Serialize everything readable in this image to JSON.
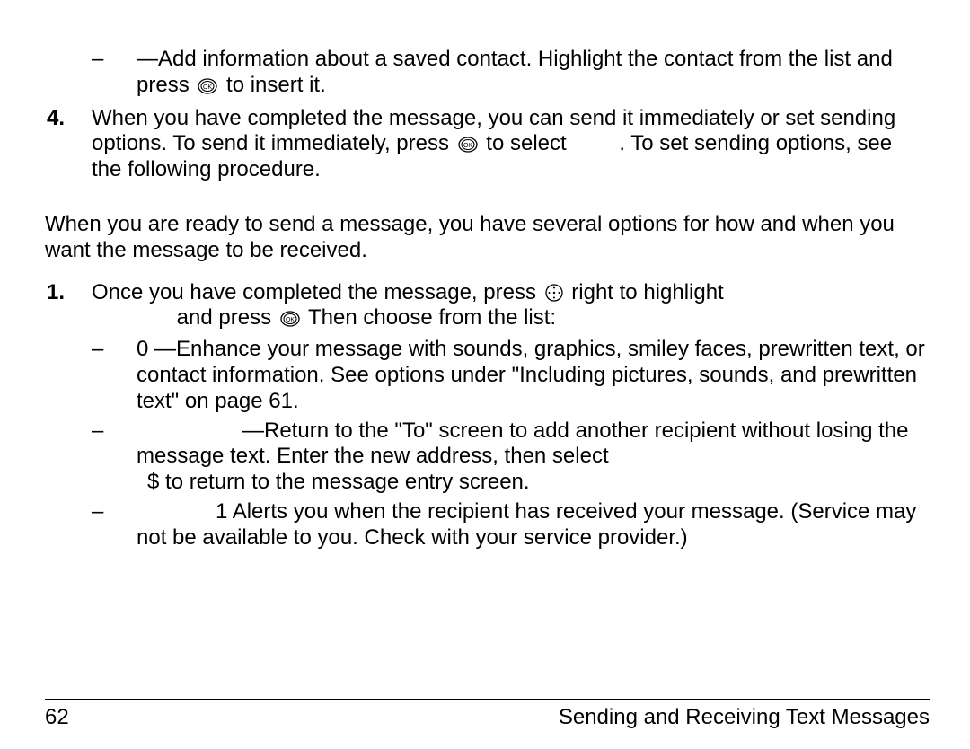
{
  "list_a": {
    "bullet_1": {
      "marker": "–",
      "text_before": "—Add information about a saved contact. Highlight the contact from the list and press ",
      "text_after": " to insert it."
    },
    "item_4": {
      "marker": "4.",
      "text_a": "When you have completed the message, you can send it immediately or set sending options. To send it immediately, press ",
      "text_b": " to select ",
      "text_c": ". To set sending options, see the following procedure."
    }
  },
  "paragraph": "When you are ready to send a message, you have several options for how and when you want the message to be received.",
  "list_b": {
    "item_1": {
      "marker": "1.",
      "text_a": "Once you have completed the message, press ",
      "text_b": " right to highlight ",
      "text_c": " and press ",
      "text_d": "  Then choose from the list:"
    },
    "bullet_1": {
      "marker": "–",
      "label": "0",
      "text": "    —Enhance your message with sounds, graphics, smiley faces, prewritten text, or contact information. See options under \"Including pictures, sounds, and prewritten text\" on page 61."
    },
    "bullet_2": {
      "marker": "–",
      "text_a": "—Return to the \"To\" screen to add another recipient without losing the message text. Enter the new address, then select ",
      "symbol": "$",
      "text_b": "  to return to the message entry screen."
    },
    "bullet_3": {
      "marker": "–",
      "label": "1",
      "text": "     Alerts you when the recipient has received your message. (Service may not be available to you. Check with your service provider.)"
    }
  },
  "footer": {
    "page_number": "62",
    "title": "Sending and Receiving Text Messages"
  }
}
